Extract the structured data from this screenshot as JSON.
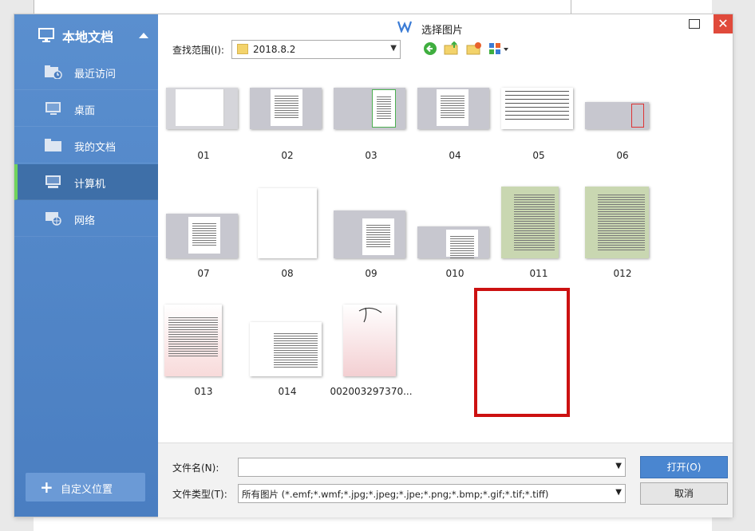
{
  "sidebar": {
    "header": "本地文档",
    "items": [
      {
        "label": "最近访问",
        "icon": "recent-folder-icon"
      },
      {
        "label": "桌面",
        "icon": "desktop-icon"
      },
      {
        "label": "我的文档",
        "icon": "folder-icon"
      },
      {
        "label": "计算机",
        "icon": "computer-icon"
      },
      {
        "label": "网络",
        "icon": "network-icon"
      }
    ],
    "active_index": 3,
    "custom_button": "自定义位置"
  },
  "window": {
    "title": "选择图片",
    "close_symbol": "✕"
  },
  "toolbar": {
    "lookin_label": "查找范围(I):",
    "lookin_value": "2018.8.2"
  },
  "files": [
    {
      "name": "01"
    },
    {
      "name": "02"
    },
    {
      "name": "03"
    },
    {
      "name": "04"
    },
    {
      "name": "05"
    },
    {
      "name": "06"
    },
    {
      "name": "07"
    },
    {
      "name": "08"
    },
    {
      "name": "09"
    },
    {
      "name": "010"
    },
    {
      "name": "011"
    },
    {
      "name": "012"
    },
    {
      "name": "013"
    },
    {
      "name": "014"
    },
    {
      "name": "002003297370..."
    }
  ],
  "bottom": {
    "filename_label": "文件名(N):",
    "filename_value": "",
    "filetype_label": "文件类型(T):",
    "filetype_value": "所有图片 (*.emf;*.wmf;*.jpg;*.jpeg;*.jpe;*.png;*.bmp;*.gif;*.tif;*.tiff)",
    "open_button": "打开(O)",
    "cancel_button": "取消"
  },
  "colors": {
    "sidebar": "#4f86c6",
    "active_indicator": "#6fd35c",
    "close_button": "#e04a3b",
    "highlight_box": "#cc1111",
    "primary_button": "#4a86d0"
  }
}
